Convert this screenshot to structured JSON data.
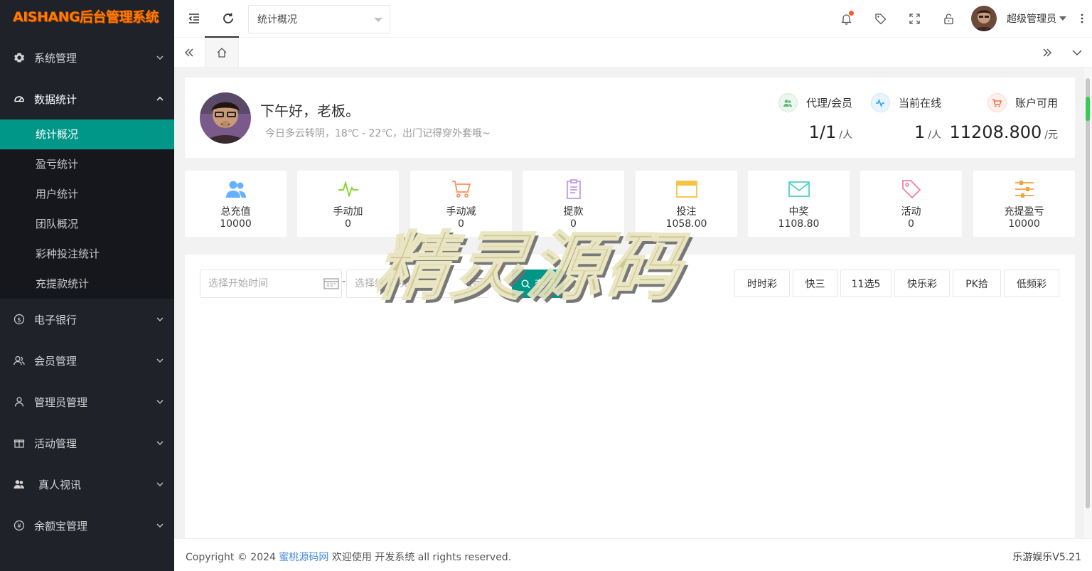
{
  "app": {
    "logo": "AISHANG后台管理系统"
  },
  "sidebar": {
    "items": [
      {
        "label": "系统管理",
        "icon": "gear-icon"
      },
      {
        "label": "数据统计",
        "icon": "dashboard-icon",
        "open": true,
        "children": [
          "统计概况",
          "盈亏统计",
          "用户统计",
          "团队概况",
          "彩种投注统计",
          "充提款统计"
        ],
        "active_child": "统计概况"
      },
      {
        "label": "电子银行",
        "icon": "dollar-icon"
      },
      {
        "label": "会员管理",
        "icon": "user-group-icon"
      },
      {
        "label": "管理员管理",
        "icon": "user-icon"
      },
      {
        "label": "活动管理",
        "icon": "gift-icon"
      },
      {
        "label": "真人视讯",
        "icon": "users-icon"
      },
      {
        "label": "余额宝管理",
        "icon": "yen-icon"
      }
    ]
  },
  "header": {
    "page_select": "统计概况",
    "user_name": "超级管理员"
  },
  "welcome": {
    "greeting": "下午好，老板。",
    "weather": "今日多云转阴，18℃ - 22℃，出门记得穿外套哦~",
    "stats": [
      {
        "label": "代理/会员",
        "value": "1/1",
        "unit": "/人",
        "color": "#5fb878"
      },
      {
        "label": "当前在线",
        "value": "1",
        "unit": "/人",
        "color": "#1e9fff"
      },
      {
        "label": "账户可用",
        "value": "11208.800",
        "unit": "/元",
        "color": "#ff5722"
      }
    ]
  },
  "cards": [
    {
      "label": "总充值",
      "value": "10000",
      "icon": "users-icon",
      "color": "#66b1ff"
    },
    {
      "label": "手动加",
      "value": "0",
      "icon": "pulse-icon",
      "color": "#7ed321"
    },
    {
      "label": "手动减",
      "value": "0",
      "icon": "cart-icon",
      "color": "#ff8c5a"
    },
    {
      "label": "提款",
      "value": "0",
      "icon": "clipboard-icon",
      "color": "#b98fe8"
    },
    {
      "label": "投注",
      "value": "1058.00",
      "icon": "window-icon",
      "color": "#f5c242"
    },
    {
      "label": "中奖",
      "value": "1108.80",
      "icon": "mail-icon",
      "color": "#4fd1c5"
    },
    {
      "label": "活动",
      "value": "0",
      "icon": "tag-icon",
      "color": "#f27da3"
    },
    {
      "label": "充提盈亏",
      "value": "10000",
      "icon": "sliders-icon",
      "color": "#f5a142"
    }
  ],
  "query": {
    "start_placeholder": "选择开始时间",
    "end_placeholder": "选择结束时间",
    "button": "查询",
    "lotteries": [
      "时时彩",
      "快三",
      "11选5",
      "快乐彩",
      "PK拾",
      "低频彩"
    ]
  },
  "watermark": "精灵源码",
  "footer": {
    "prefix": "Copyright © 2024 ",
    "link": "蜜桃源码网",
    "suffix": " 欢迎使用 开发系统 all rights reserved.",
    "version": "乐游娱乐V5.21"
  }
}
